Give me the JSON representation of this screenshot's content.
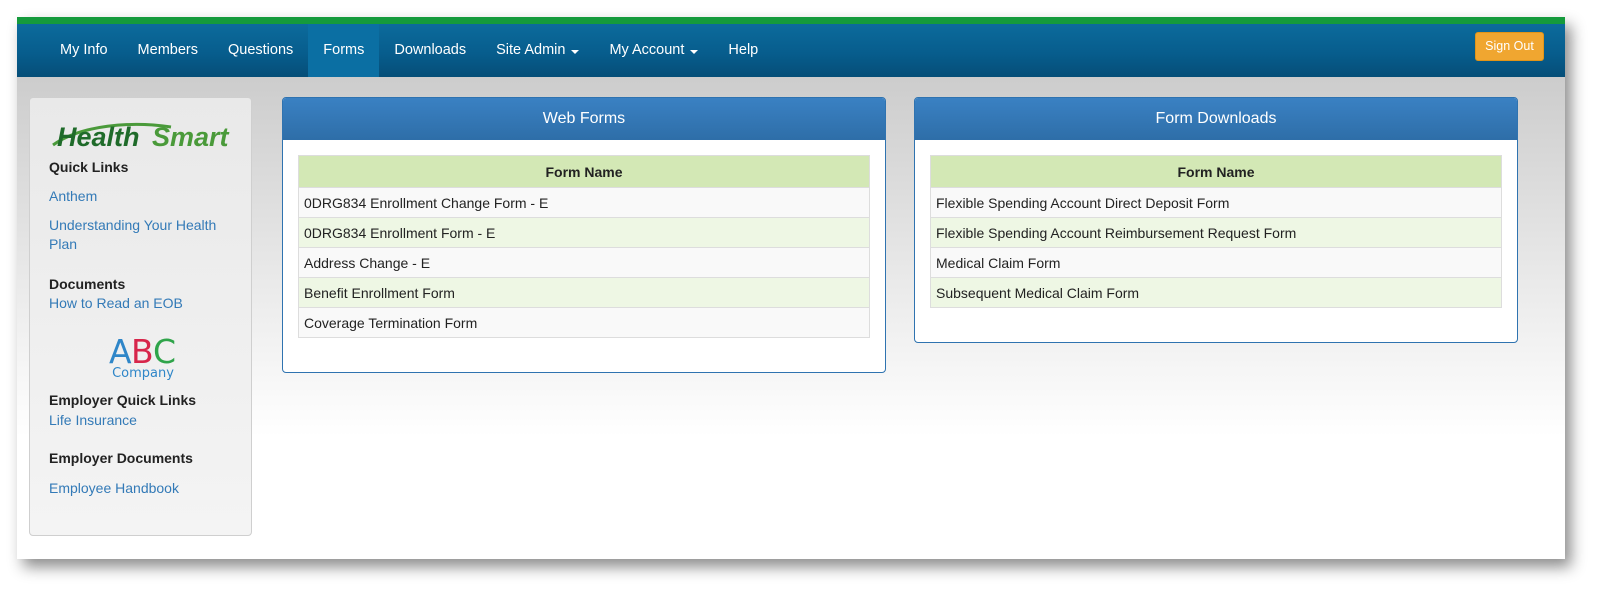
{
  "nav": {
    "items": [
      {
        "label": "My Info",
        "dropdown": false,
        "active": false
      },
      {
        "label": "Members",
        "dropdown": false,
        "active": false
      },
      {
        "label": "Questions",
        "dropdown": false,
        "active": false
      },
      {
        "label": "Forms",
        "dropdown": false,
        "active": true
      },
      {
        "label": "Downloads",
        "dropdown": false,
        "active": false
      },
      {
        "label": "Site Admin",
        "dropdown": true,
        "active": false
      },
      {
        "label": "My Account",
        "dropdown": true,
        "active": false
      },
      {
        "label": "Help",
        "dropdown": false,
        "active": false
      }
    ],
    "signout_label": "Sign Out"
  },
  "sidebar": {
    "logo_text_left": "Health",
    "logo_text_right": "Smart",
    "quick_links_heading": "Quick Links",
    "quick_links": [
      "Anthem",
      "Understanding Your Health Plan"
    ],
    "documents_heading": "Documents",
    "documents": [
      "How to Read an EOB"
    ],
    "company_logo_letters": [
      "A",
      "B",
      "C"
    ],
    "company_logo_word": "Company",
    "employer_quick_links_heading": "Employer Quick Links",
    "employer_quick_links": [
      "Life Insurance"
    ],
    "employer_documents_heading": "Employer Documents",
    "employer_documents": [
      "Employee Handbook"
    ]
  },
  "web_forms": {
    "title": "Web Forms",
    "column_header": "Form Name",
    "rows": [
      "0DRG834 Enrollment Change Form - E",
      "0DRG834 Enrollment Form - E",
      "Address Change - E",
      "Benefit Enrollment Form",
      "Coverage Termination Form"
    ]
  },
  "form_downloads": {
    "title": "Form Downloads",
    "column_header": "Form Name",
    "rows": [
      "Flexible Spending Account Direct Deposit Form",
      "Flexible Spending Account Reimbursement Request Form",
      "Medical Claim Form",
      "Subsequent Medical Claim Form"
    ]
  },
  "colors": {
    "green_strip": "#159a3c",
    "navbar": "#075d8d",
    "signout": "#f0a630",
    "panel_header": "#337ab7",
    "table_header": "#d3e8b5",
    "link": "#337ab7",
    "logo_green": "#4a9a3a",
    "logo_dark": "#1f6b2a"
  }
}
